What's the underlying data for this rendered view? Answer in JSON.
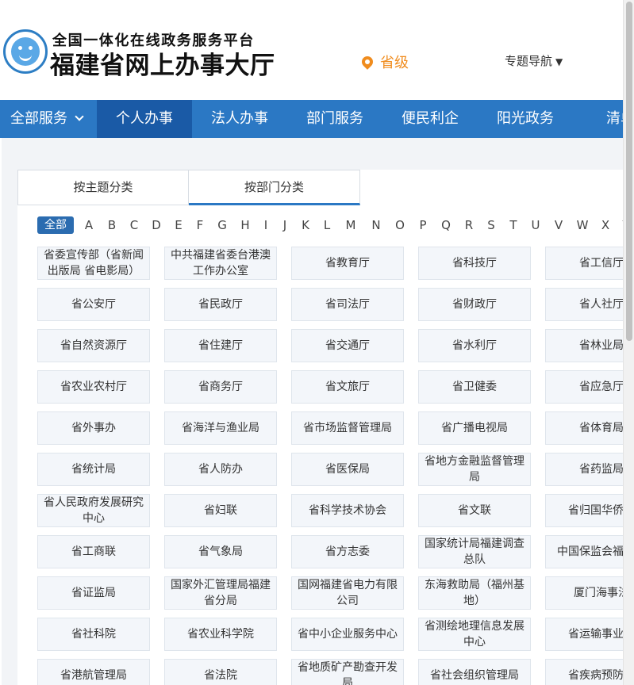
{
  "header": {
    "subtitle": "全国一体化在线政务服务平台",
    "title": "福建省网上办事大厅",
    "location": "省级",
    "topic_nav": "专题导航",
    "topic_nav_arrow": "▼"
  },
  "nav": {
    "all_services": "全部服务",
    "items": [
      "个人办事",
      "法人办事",
      "部门服务",
      "便民利企",
      "阳光政务",
      "清单"
    ]
  },
  "tabs": [
    "按主题分类",
    "按部门分类"
  ],
  "alphabet": {
    "all": "全部",
    "letters": [
      "A",
      "B",
      "C",
      "D",
      "E",
      "F",
      "G",
      "H",
      "I",
      "J",
      "K",
      "L",
      "M",
      "N",
      "O",
      "P",
      "Q",
      "R",
      "S",
      "T",
      "U",
      "V",
      "W",
      "X",
      "Y"
    ]
  },
  "departments": [
    "省委宣传部（省新闻出版局 省电影局）",
    "中共福建省委台港澳工作办公室",
    "省教育厅",
    "省科技厅",
    "省工信厅",
    "省公安厅",
    "省民政厅",
    "省司法厅",
    "省财政厅",
    "省人社厅",
    "省自然资源厅",
    "省住建厅",
    "省交通厅",
    "省水利厅",
    "省林业局",
    "省农业农村厅",
    "省商务厅",
    "省文旅厅",
    "省卫健委",
    "省应急厅",
    "省外事办",
    "省海洋与渔业局",
    "省市场监督管理局",
    "省广播电视局",
    "省体育局",
    "省统计局",
    "省人防办",
    "省医保局",
    "省地方金融监督管理局",
    "省药监局",
    "省人民政府发展研究中心",
    "省妇联",
    "省科学技术协会",
    "省文联",
    "省归国华侨联",
    "省工商联",
    "省气象局",
    "省方志委",
    "国家统计局福建调查总队",
    "中国保监会福建局",
    "省证监局",
    "国家外汇管理局福建省分局",
    "国网福建省电力有限公司",
    "东海救助局（福州基地）",
    "厦门海事法",
    "省社科院",
    "省农业科学院",
    "省中小企业服务中心",
    "省测绘地理信息发展中心",
    "省运输事业发",
    "省港航管理局",
    "省法院",
    "省地质矿产勘查开发局",
    "省社会组织管理局",
    "省疾病预防控"
  ]
}
